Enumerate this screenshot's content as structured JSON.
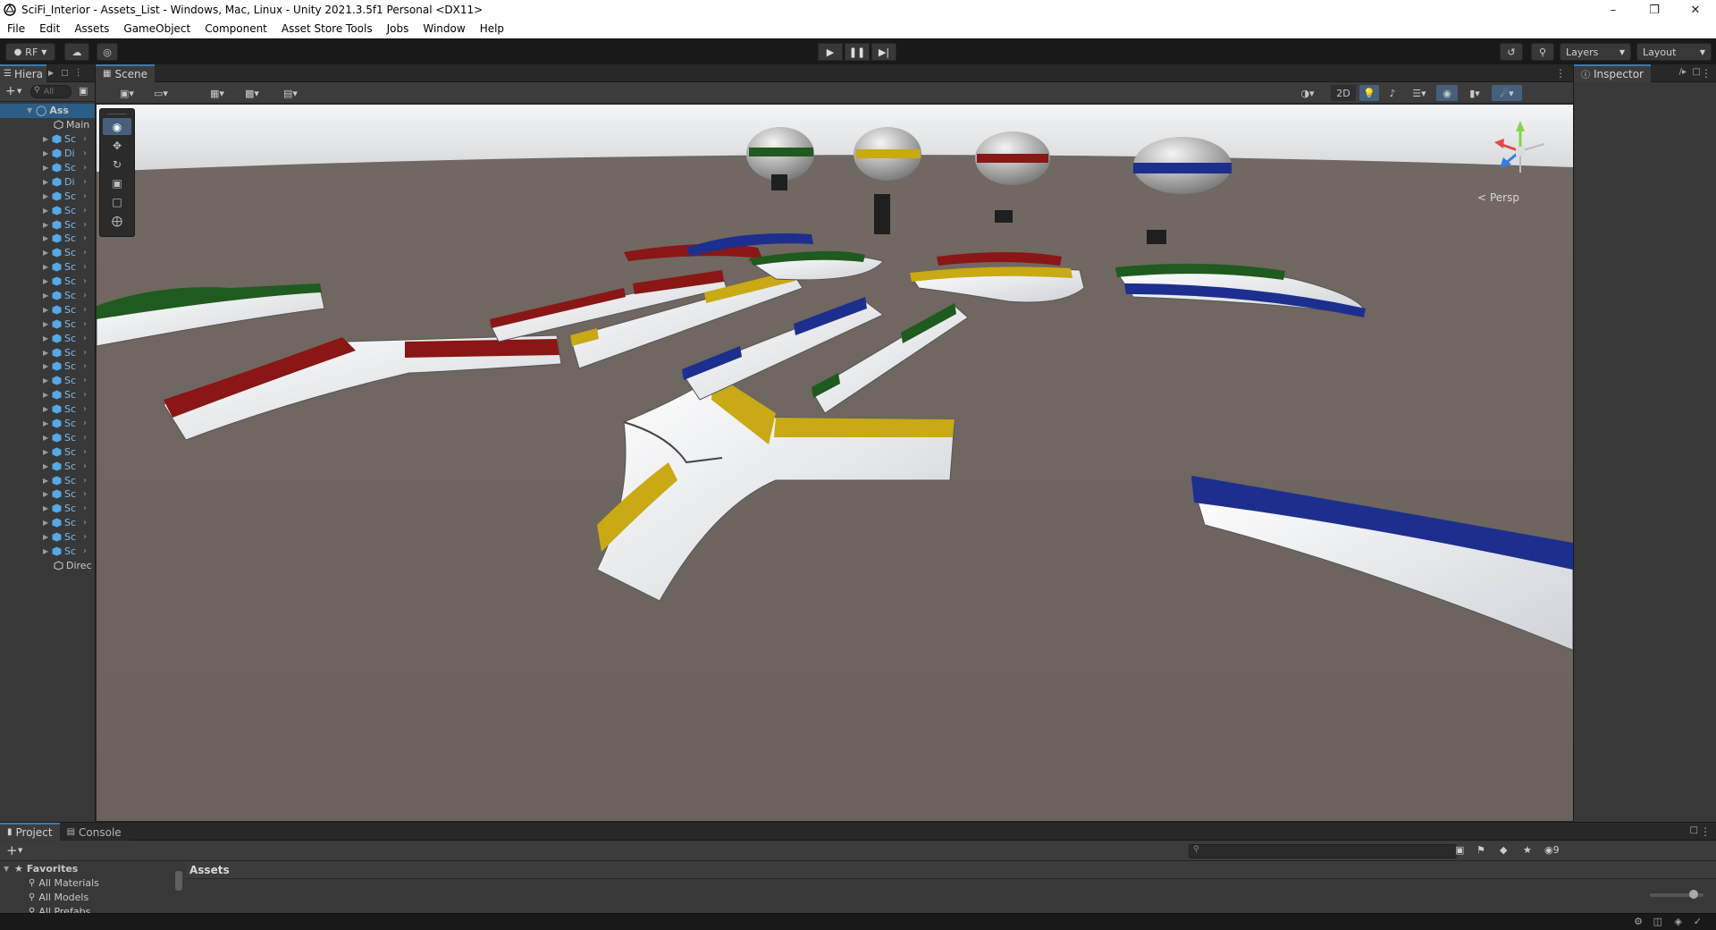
{
  "window": {
    "title": "SciFi_Interior - Assets_List - Windows, Mac, Linux - Unity 2021.3.5f1 Personal <DX11>"
  },
  "menu": [
    "File",
    "Edit",
    "Assets",
    "GameObject",
    "Component",
    "Asset Store Tools",
    "Jobs",
    "Window",
    "Help"
  ],
  "toolbar": {
    "account_label": "RF",
    "layers_label": "Layers",
    "layout_label": "Layout"
  },
  "hierarchy": {
    "tab_label": "Hiera",
    "search_placeholder": "All",
    "scene_root": "Ass",
    "rows": [
      {
        "label": "Main",
        "kind": "object"
      },
      {
        "label": "Sc",
        "kind": "prefab"
      },
      {
        "label": "Di",
        "kind": "prefab"
      },
      {
        "label": "Sc",
        "kind": "prefab"
      },
      {
        "label": "Di",
        "kind": "prefab"
      },
      {
        "label": "Sc",
        "kind": "prefab"
      },
      {
        "label": "Sc",
        "kind": "prefab"
      },
      {
        "label": "Sc",
        "kind": "prefab"
      },
      {
        "label": "Sc",
        "kind": "prefab"
      },
      {
        "label": "Sc",
        "kind": "prefab"
      },
      {
        "label": "Sc",
        "kind": "prefab"
      },
      {
        "label": "Sc",
        "kind": "prefab"
      },
      {
        "label": "Sc",
        "kind": "prefab"
      },
      {
        "label": "Sc",
        "kind": "prefab"
      },
      {
        "label": "Sc",
        "kind": "prefab"
      },
      {
        "label": "Sc",
        "kind": "prefab"
      },
      {
        "label": "Sc",
        "kind": "prefab"
      },
      {
        "label": "Sc",
        "kind": "prefab"
      },
      {
        "label": "Sc",
        "kind": "prefab"
      },
      {
        "label": "Sc",
        "kind": "prefab"
      },
      {
        "label": "Sc",
        "kind": "prefab"
      },
      {
        "label": "Sc",
        "kind": "prefab"
      },
      {
        "label": "Sc",
        "kind": "prefab"
      },
      {
        "label": "Sc",
        "kind": "prefab"
      },
      {
        "label": "Sc",
        "kind": "prefab"
      },
      {
        "label": "Sc",
        "kind": "prefab"
      },
      {
        "label": "Sc",
        "kind": "prefab"
      },
      {
        "label": "Sc",
        "kind": "prefab"
      },
      {
        "label": "Sc",
        "kind": "prefab"
      },
      {
        "label": "Sc",
        "kind": "prefab"
      },
      {
        "label": "Sc",
        "kind": "prefab"
      },
      {
        "label": "Direc",
        "kind": "object"
      }
    ]
  },
  "scene": {
    "tab_label": "Scene",
    "mode_2d_label": "2D",
    "persp_label": "< Persp"
  },
  "inspector": {
    "tab_label": "Inspector"
  },
  "project": {
    "tab_project": "Project",
    "tab_console": "Console",
    "favorites_label": "Favorites",
    "favorites": [
      "All Materials",
      "All Models",
      "All Prefabs"
    ],
    "assets_header": "Assets",
    "hidden_count": "9"
  },
  "colors": {
    "accent": "#3a79bb",
    "ground": "#6d655f",
    "sky": "#e8ecef",
    "red": "#8a1616",
    "yellow": "#c9a914",
    "green": "#1f5a1f",
    "blue": "#1d2f8e"
  }
}
